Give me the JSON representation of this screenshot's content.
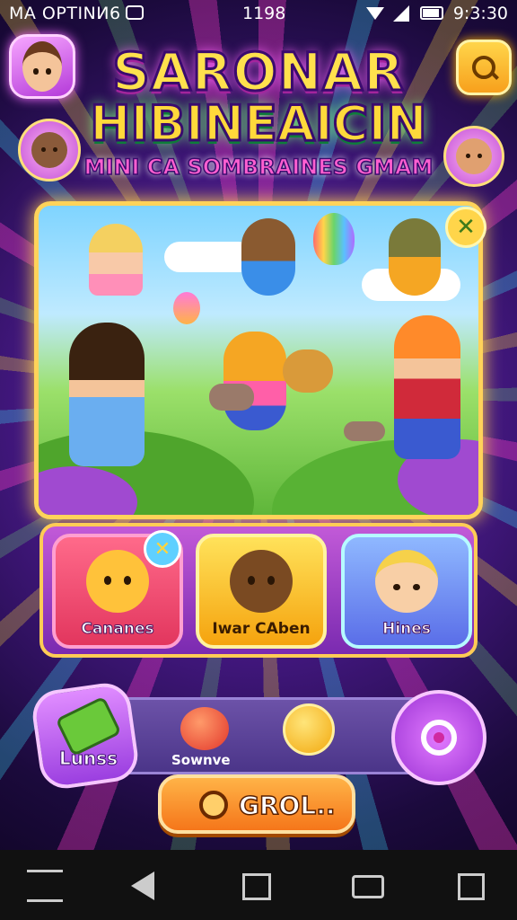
{
  "status_bar": {
    "carrier": "MA OPTINИ6",
    "center": "1198",
    "time": "9:3:30",
    "icons": [
      "chat-icon",
      "wifi-icon",
      "signal-icon",
      "battery-icon"
    ]
  },
  "header": {
    "title_line1": "SARONAR",
    "title_line2": "HIBINEAICIN",
    "subtitle": "MINI CA SOMBRAINES GMAM"
  },
  "cards": [
    {
      "label": "Cananes",
      "icon": "bear-icon"
    },
    {
      "label": "Iwar CAben",
      "icon": "brown-bear-icon"
    },
    {
      "label": "Hines",
      "icon": "girl-icon"
    }
  ],
  "bottom": {
    "lives_label": "Lunss",
    "sound_label": "Sownve",
    "go_label": "GROL.."
  },
  "colors": {
    "accent_gold": "#ffd35a",
    "purple": "#9b3fe0",
    "orange": "#f5761a"
  }
}
